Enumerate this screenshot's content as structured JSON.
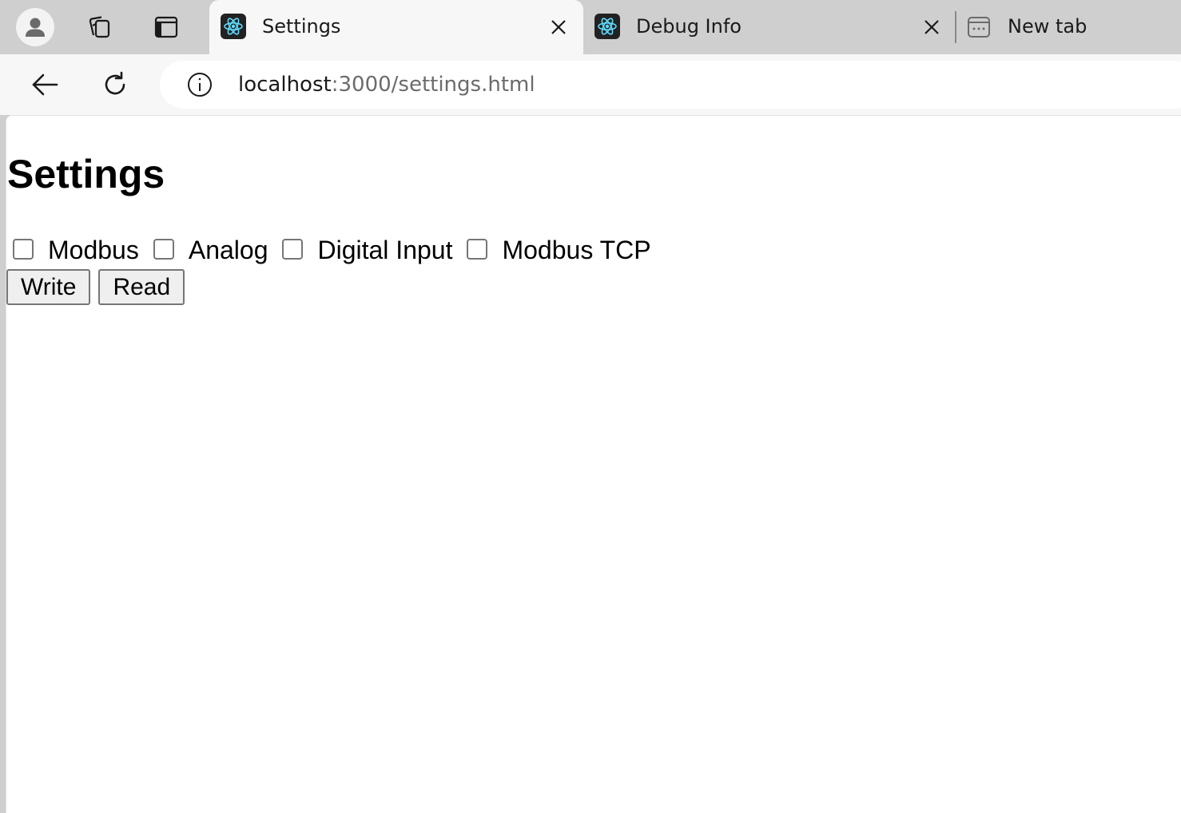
{
  "browser": {
    "tabs": [
      {
        "title": "Settings",
        "active": true,
        "favicon": "react-icon"
      },
      {
        "title": "Debug Info",
        "active": false,
        "favicon": "react-icon"
      },
      {
        "title": "New tab",
        "active": false,
        "favicon": "new-tab-icon"
      }
    ],
    "address": {
      "host": "localhost",
      "path": ":3000/settings.html"
    },
    "colors": {
      "tabstrip": "#cfcfcf",
      "active_tab": "#f7f7f7",
      "react_accent": "#61dafb"
    }
  },
  "page": {
    "title": "Settings",
    "checkboxes": [
      {
        "label": "Modbus",
        "checked": false
      },
      {
        "label": "Analog",
        "checked": false
      },
      {
        "label": "Digital Input",
        "checked": false
      },
      {
        "label": "Modbus TCP",
        "checked": false
      }
    ],
    "buttons": {
      "write": "Write",
      "read": "Read"
    }
  }
}
